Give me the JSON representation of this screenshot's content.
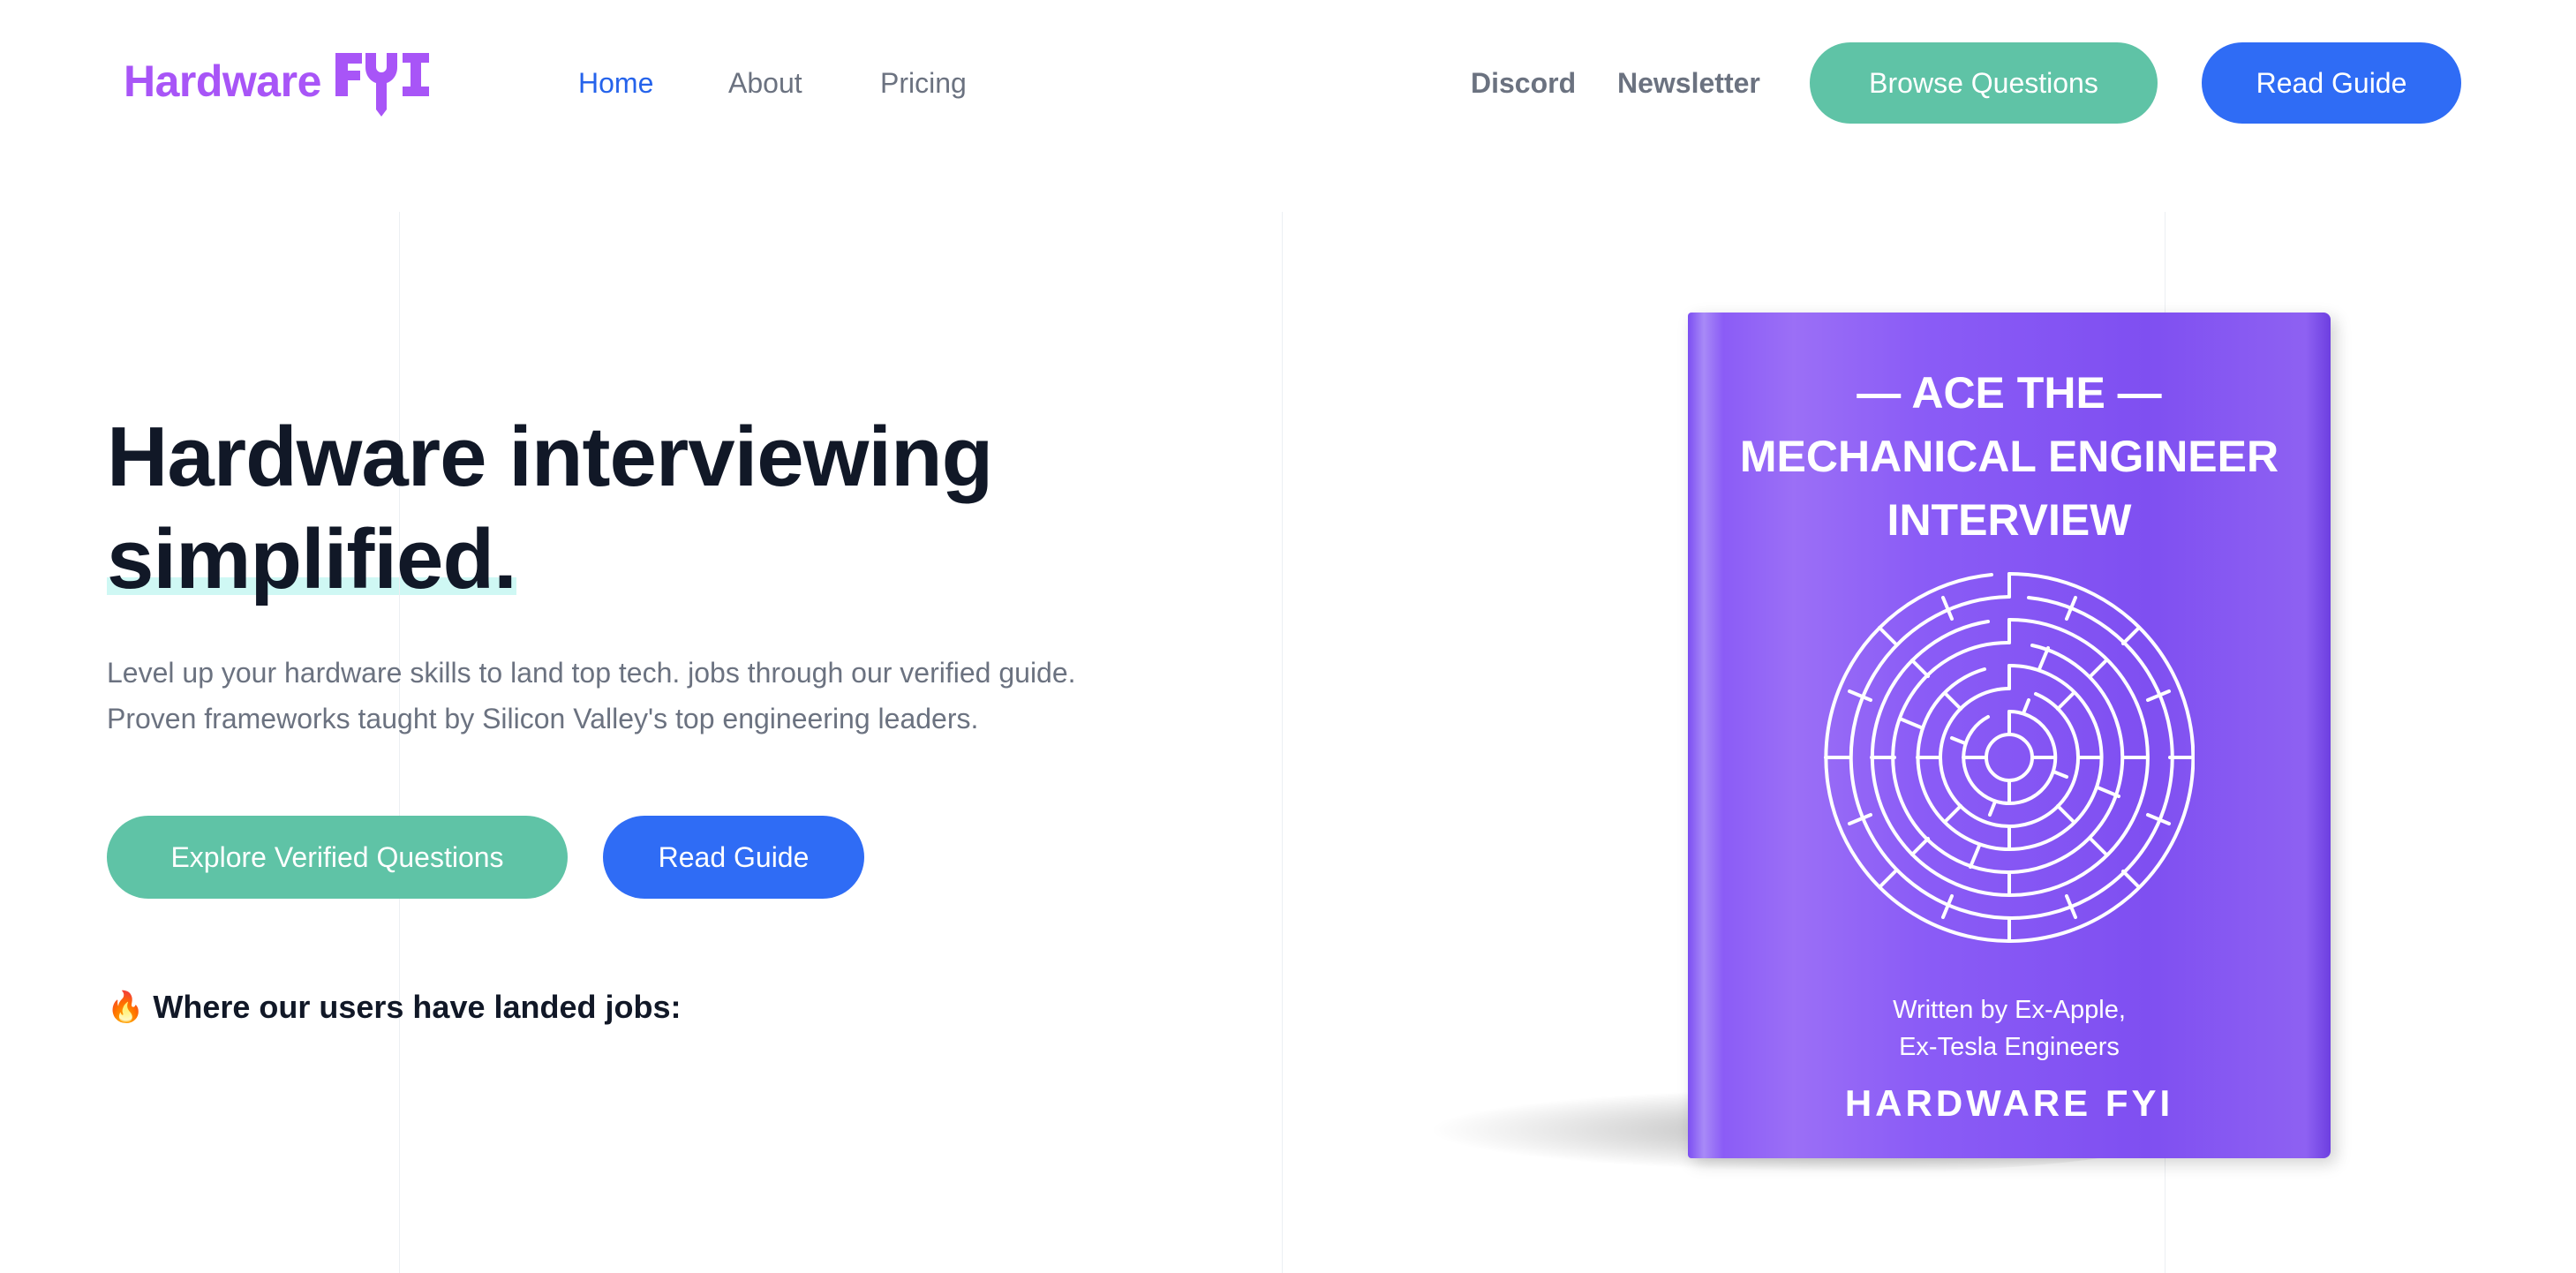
{
  "brand": {
    "word": "Hardware",
    "mark": "FYI",
    "color": "#a855f7"
  },
  "nav": {
    "home": "Home",
    "about": "About",
    "pricing": "Pricing",
    "discord": "Discord",
    "newsletter": "Newsletter",
    "browse_questions": "Browse Questions",
    "read_guide": "Read Guide"
  },
  "hero": {
    "title_line1": "Hardware interviewing",
    "title_line2": "simplified.",
    "subtitle_line1": "Level up your hardware skills to land top tech. jobs through our verified guide.",
    "subtitle_line2": "Proven frameworks taught by Silicon Valley's top engineering leaders.",
    "cta_primary": "Explore Verified Questions",
    "cta_secondary": "Read Guide",
    "landed_icon": "🔥",
    "landed_text": "Where our users have landed jobs:"
  },
  "book": {
    "line1": "— ACE THE —",
    "line2": "MECHANICAL ENGINEER",
    "line3": "INTERVIEW",
    "written_by_1": "Written by Ex-Apple,",
    "written_by_2": "Ex-Tesla Engineers",
    "brand": "HARDWARE FYI",
    "cover_color": "#8b5cf6",
    "maze_icon": "circular-maze-icon"
  },
  "colors": {
    "accent_blue": "#2f6cf5",
    "accent_green": "#5fc3a6",
    "text_dark": "#111827",
    "text_muted": "#6b7280"
  }
}
